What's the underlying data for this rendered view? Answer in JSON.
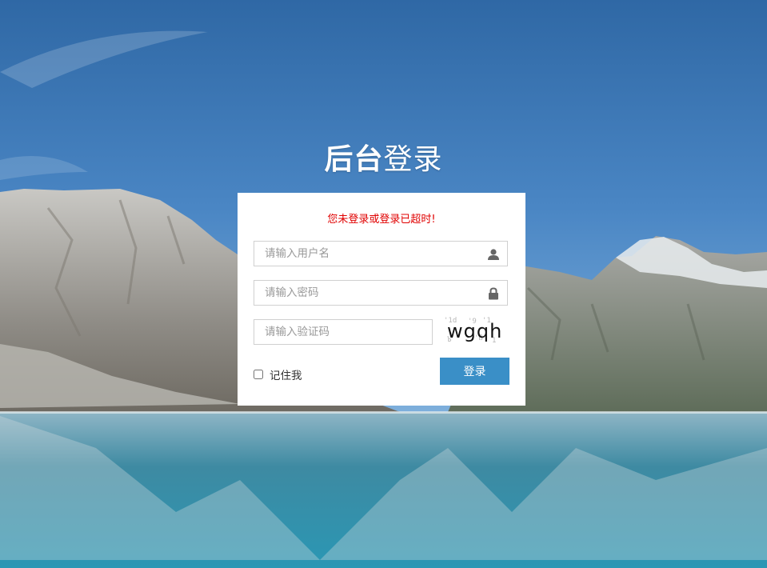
{
  "header": {
    "title_bold": "后台",
    "title_light": "登录"
  },
  "login": {
    "error_message": "您未登录或登录已超时!",
    "username_placeholder": "请输入用户名",
    "password_placeholder": "请输入密码",
    "captcha_placeholder": "请输入验证码",
    "captcha_text": "wgqh",
    "remember_label": "记住我",
    "submit_label": "登录"
  },
  "icons": {
    "username": "user-icon",
    "password": "lock-icon"
  },
  "colors": {
    "error": "#e00000",
    "button": "#3a8fc7",
    "panel": "#ffffff"
  }
}
